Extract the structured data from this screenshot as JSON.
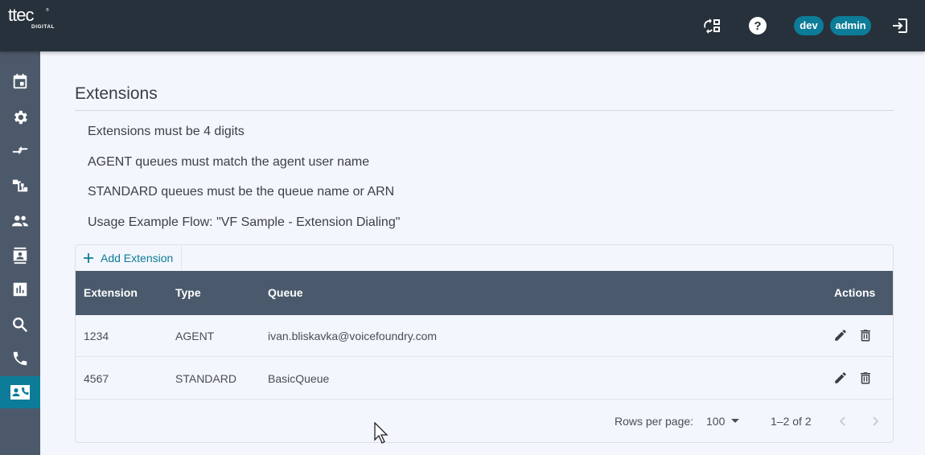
{
  "brand": {
    "name": "ttec",
    "sub": "DIGITAL",
    "reg": "®"
  },
  "header": {
    "tags": [
      "dev",
      "admin"
    ],
    "icons": [
      "swap-panel-icon",
      "help-icon",
      "logout-icon"
    ]
  },
  "sidebar": {
    "items": [
      {
        "icon": "calendar-icon",
        "active": false
      },
      {
        "icon": "gear-icon",
        "active": false
      },
      {
        "icon": "transfer-arrows-icon",
        "active": false
      },
      {
        "icon": "flow-tree-icon",
        "active": false
      },
      {
        "icon": "people-icon",
        "active": false
      },
      {
        "icon": "contact-card-icon",
        "active": false
      },
      {
        "icon": "bar-chart-icon",
        "active": false
      },
      {
        "icon": "search-icon",
        "active": false
      },
      {
        "icon": "phone-icon",
        "active": false
      },
      {
        "icon": "contact-phone-icon",
        "active": true
      }
    ]
  },
  "page": {
    "title": "Extensions",
    "notes": [
      "Extensions must be 4 digits",
      "AGENT queues must match the agent user name",
      "STANDARD queues must be the queue name or ARN",
      "Usage Example Flow: \"VF Sample - Extension Dialing\""
    ]
  },
  "toolbar": {
    "add_label": "Add Extension"
  },
  "table": {
    "columns": [
      "Extension",
      "Type",
      "Queue",
      "Actions"
    ],
    "rows": [
      {
        "extension": "1234",
        "type": "AGENT",
        "queue": "ivan.bliskavka@voicefoundry.com"
      },
      {
        "extension": "4567",
        "type": "STANDARD",
        "queue": "BasicQueue"
      }
    ]
  },
  "pagination": {
    "rows_per_page_label": "Rows per page:",
    "rows_per_page_value": "100",
    "range": "1–2 of 2"
  },
  "colors": {
    "topbar": "#27313b",
    "sidebar": "#4c596a",
    "accent": "#0c7c98",
    "table_header": "#4a596b",
    "background": "#f3f6fc"
  }
}
